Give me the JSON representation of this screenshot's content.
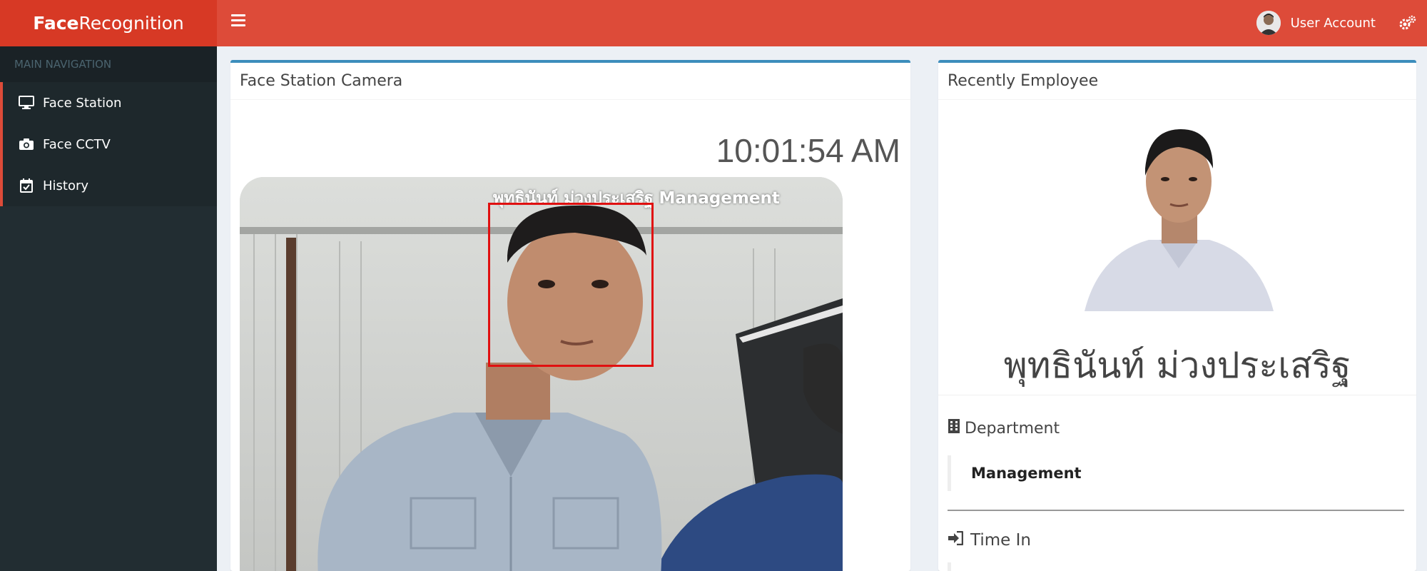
{
  "header": {
    "logo_bold": "Face",
    "logo_rest": "Recognition",
    "user_label": "User Account"
  },
  "sidebar": {
    "section_title": "MAIN NAVIGATION",
    "items": [
      {
        "label": "Face Station",
        "icon": "monitor-icon"
      },
      {
        "label": "Face CCTV",
        "icon": "camera-icon"
      },
      {
        "label": "History",
        "icon": "calendar-check-icon"
      }
    ]
  },
  "camera_panel": {
    "title": "Face Station Camera",
    "clock": "10:01:54 AM",
    "overlay_label": "พุทธินันท์ ม่วงประเสริฐ  Management"
  },
  "employee_panel": {
    "title": "Recently Employee",
    "name": "พุทธินันท์ ม่วงประเสริฐ",
    "department_label": "Department",
    "department_value": "Management",
    "time_in_label": "Time In"
  },
  "colors": {
    "header_red": "#dd4b39",
    "logo_red": "#d73925",
    "sidebar_dark": "#222d32",
    "box_top_blue": "#3c8dbc",
    "face_box_red": "#e01010"
  }
}
